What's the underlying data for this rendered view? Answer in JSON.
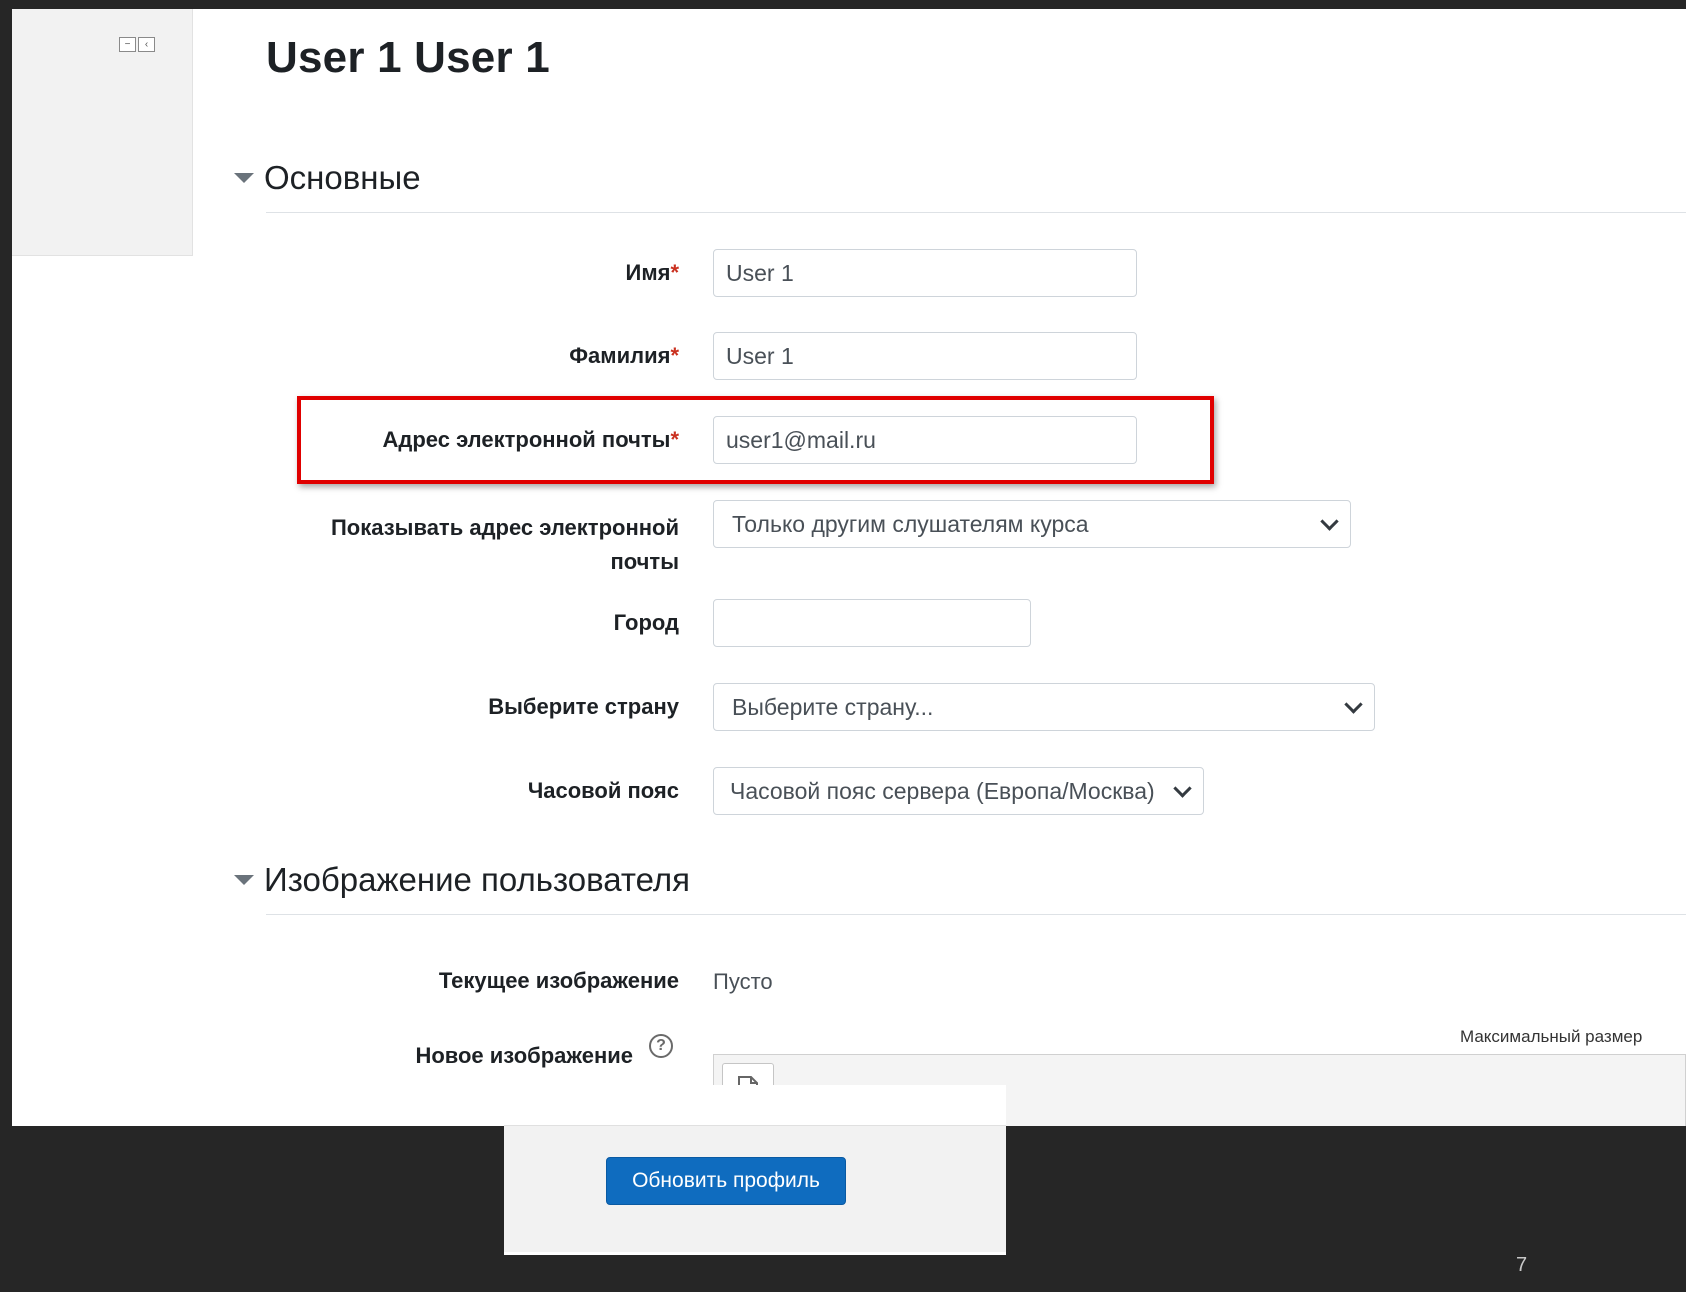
{
  "page": {
    "title": "User 1 User 1",
    "page_number": "7"
  },
  "dock": {
    "icons": [
      "minus-box-icon",
      "arrow-left-box-icon"
    ]
  },
  "sections": {
    "general": "Основные",
    "user_picture": "Изображение пользователя"
  },
  "fields": {
    "firstname": {
      "label": "Имя",
      "required_mark": "*",
      "value": "User 1"
    },
    "lastname": {
      "label": "Фамилия",
      "required_mark": "*",
      "value": "User 1"
    },
    "email": {
      "label": "Адрес электронной почты",
      "required_mark": "*",
      "value": "user1@mail.ru"
    },
    "maildisplay": {
      "label": "Показывать адрес электронной почты",
      "selected": "Только другим слушателям курса"
    },
    "city": {
      "label": "Город",
      "value": ""
    },
    "country": {
      "label": "Выберите страну",
      "selected": "Выберите страну..."
    },
    "timezone": {
      "label": "Часовой пояс",
      "selected": "Часовой пояс сервера (Европа/Москва)"
    }
  },
  "picture": {
    "current_label": "Текущее изображение",
    "current_value": "Пусто",
    "new_label": "Новое изображение",
    "help_glyph": "?",
    "max_size_text": "Максимальный размер"
  },
  "footer": {
    "submit_label": "Обновить профиль"
  },
  "colors": {
    "accent": "#0f6cbf",
    "required": "#ca3120",
    "highlight": "#e00000",
    "background": "#262626"
  }
}
